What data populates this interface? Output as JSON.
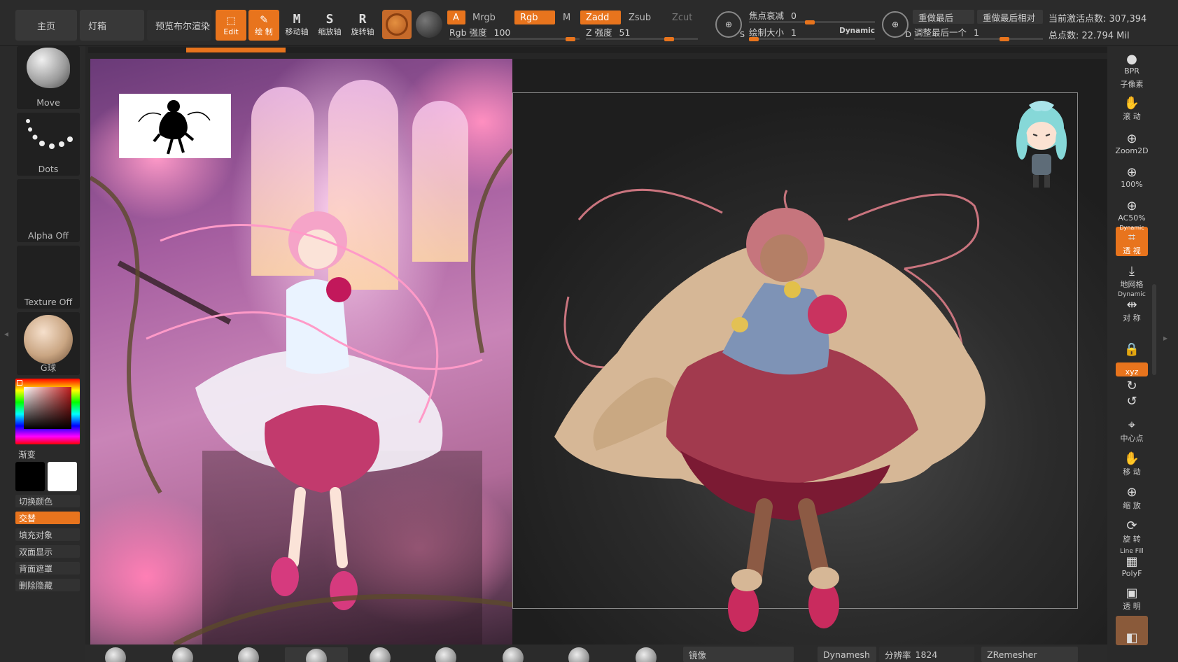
{
  "topbar": {
    "home_label": "主页",
    "lightbox_label": "灯箱",
    "bpr_preview_label": "预览布尔渲染",
    "tools": [
      {
        "glyph": "⬚",
        "label": "Edit",
        "active": true
      },
      {
        "glyph": "✎",
        "label": "绘 制",
        "active": true
      },
      {
        "glyph": "M",
        "label": "移动轴",
        "active": false
      },
      {
        "glyph": "S",
        "label": "缩放轴",
        "active": false
      },
      {
        "glyph": "R",
        "label": "旋转轴",
        "active": false
      }
    ],
    "modes": {
      "a": "A",
      "mrgb": "Mrgb",
      "rgb": "Rgb",
      "m": "M",
      "zadd": "Zadd",
      "zsub": "Zsub",
      "zcut": "Zcut"
    },
    "rgb_intensity_label": "Rgb 强度",
    "rgb_intensity_value": "100",
    "z_intensity_label": "Z 强度",
    "z_intensity_value": "51",
    "focal_shift_label": "焦点衰减",
    "focal_shift_value": "0",
    "draw_size_label": "绘制大小",
    "draw_size_value": "1",
    "dynamic_label": "Dynamic",
    "s_icon_letter": "S",
    "d_icon_letter": "D",
    "redo_last_label": "重做最后",
    "redo_last_relative_label": "重做最后相对",
    "adjust_last_label": "调整最后一个",
    "adjust_last_value": "1",
    "active_points_text": "当前激活点数: 307,394",
    "total_points_text": "总点数: 22.794 Mil"
  },
  "leftpanel": {
    "brush_label": "Move",
    "stroke_label": "Dots",
    "alpha_label": "Alpha Off",
    "texture_label": "Texture Off",
    "material_label": "G球",
    "gradient_label": "渐变",
    "switch_color_label": "切换颜色",
    "alternate_label": "交替",
    "fill_object_label": "填充对象",
    "double_sided_label": "双面显示",
    "backface_mask_label": "背面遮罩",
    "delete_hidden_label": "删除隐藏"
  },
  "rightpanel": {
    "items": [
      {
        "icon": "bpr-icon",
        "glyph": "●",
        "label": "BPR",
        "on": false
      },
      {
        "icon": "subpixel-icon",
        "glyph": "",
        "label": "子像素",
        "on": false
      },
      {
        "icon": "scroll-hand-icon",
        "glyph": "✋",
        "label": "滚 动",
        "on": false
      },
      {
        "icon": "zoom2d-icon",
        "glyph": "⊕",
        "label": "Zoom2D",
        "on": false
      },
      {
        "icon": "zoom100-icon",
        "glyph": "⊕",
        "label": "100%",
        "on": false
      },
      {
        "icon": "ac50-icon",
        "glyph": "⊕",
        "label": "AC50%",
        "on": false
      },
      {
        "icon": "perspective-icon",
        "glyph": "⌗",
        "label": "透 视",
        "on": true
      },
      {
        "icon": "floor-icon",
        "glyph": "⤓",
        "label": "地网格",
        "on": false
      },
      {
        "icon": "symmetry-icon",
        "glyph": "⇹",
        "label": "对 称",
        "on": false
      },
      {
        "icon": "lock-icon",
        "glyph": "🔒",
        "label": "",
        "on": false
      },
      {
        "icon": "xyz-icon",
        "glyph": "",
        "label": "xyz",
        "on": true
      },
      {
        "icon": "rotate-y-icon",
        "glyph": "↻",
        "label": "",
        "on": false
      },
      {
        "icon": "rotate-z-icon",
        "glyph": "↺",
        "label": "",
        "on": false
      },
      {
        "icon": "center-point-icon",
        "glyph": "⌖",
        "label": "中心点",
        "on": false
      },
      {
        "icon": "move-hand-icon",
        "glyph": "✋",
        "label": "移 动",
        "on": false
      },
      {
        "icon": "scale-icon",
        "glyph": "⊕",
        "label": "缩 放",
        "on": false
      },
      {
        "icon": "rotate-icon",
        "glyph": "⟳",
        "label": "旋 转",
        "on": false
      },
      {
        "icon": "polyf-icon",
        "glyph": "▦",
        "label": "PolyF",
        "on": false
      },
      {
        "icon": "transparent-icon",
        "glyph": "▣",
        "label": "透 明",
        "on": false
      },
      {
        "icon": "ghost-icon",
        "glyph": "◧",
        "label": "",
        "on": true
      }
    ],
    "dynamic_label": "Dynamic",
    "line_fill_label": "Line Fill"
  },
  "bottombar": {
    "mirror_label": "镜像",
    "dynamesh_label": "Dynamesh",
    "resolution_label": "分辨率",
    "resolution_value": "1824",
    "zremesher_label": "ZRemesher"
  },
  "colors": {
    "accent": "#e8741d",
    "panel": "#2a2a2a",
    "left_edge": "#e3a21a"
  }
}
